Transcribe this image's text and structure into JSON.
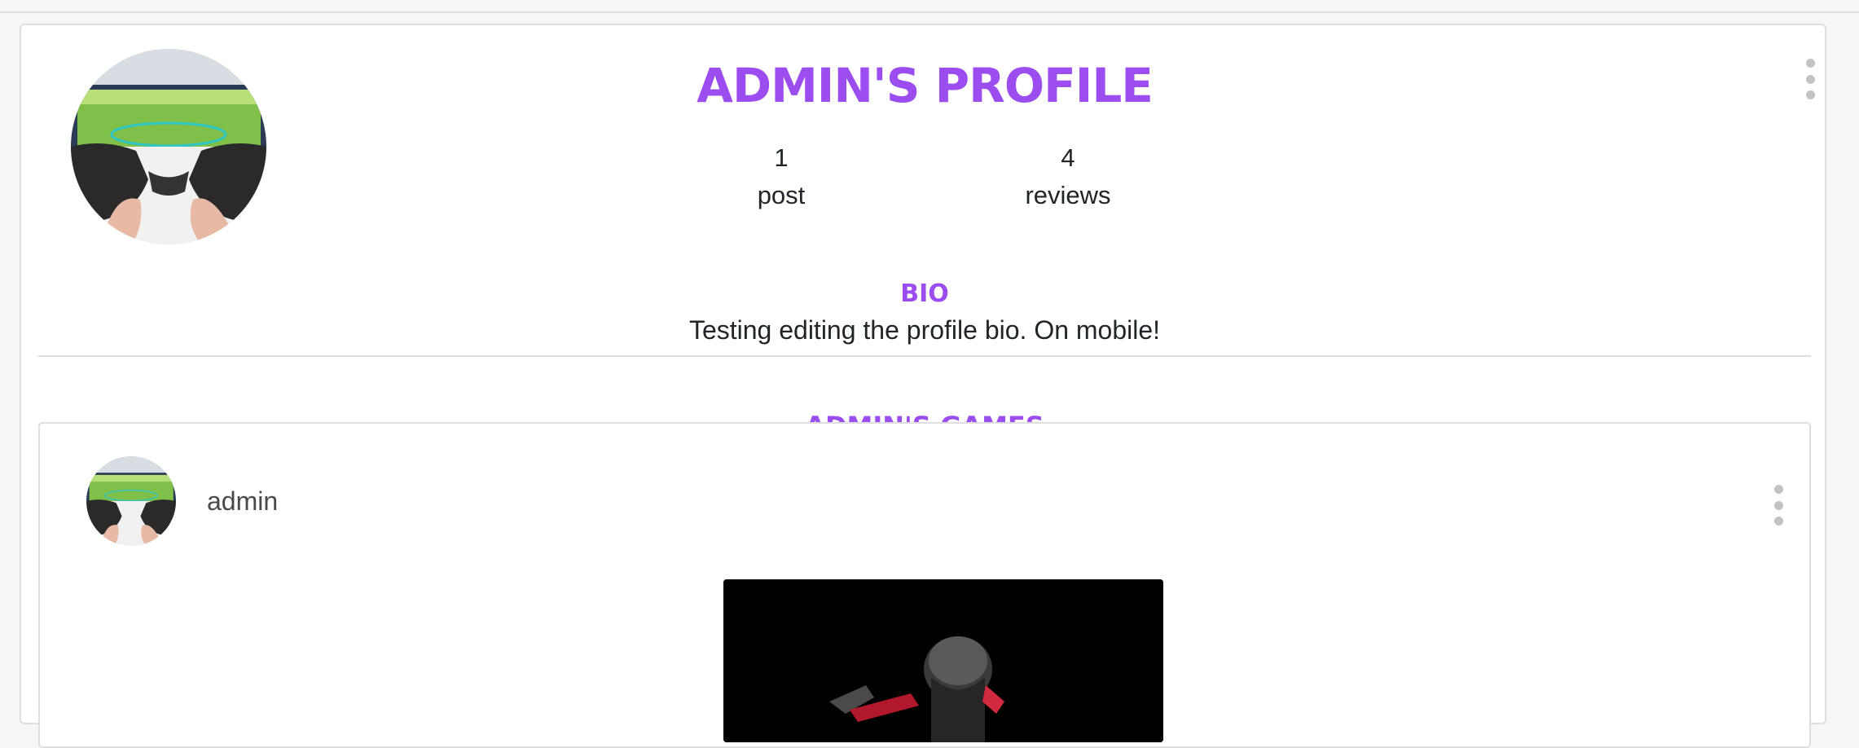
{
  "profile": {
    "title": "ADMIN'S PROFILE",
    "stats": [
      {
        "value": "1",
        "label": "post"
      },
      {
        "value": "4",
        "label": "reviews"
      }
    ],
    "bio_heading": "BIO",
    "bio_text": "Testing editing the profile bio. On mobile!",
    "games_heading": "ADMIN'S GAMES"
  },
  "post": {
    "username": "admin"
  },
  "icons": {
    "profile_menu": "kebab-menu-icon",
    "post_menu": "kebab-menu-icon"
  },
  "colors": {
    "accent": "#9b4df0",
    "border": "#dedede"
  }
}
